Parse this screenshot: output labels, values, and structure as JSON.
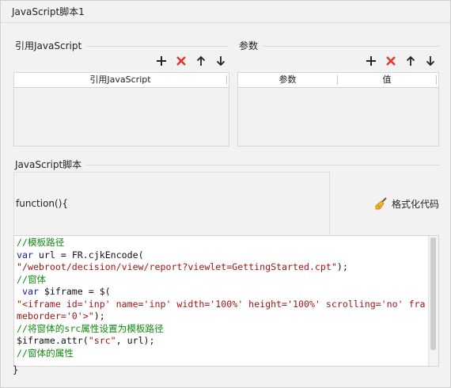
{
  "window": {
    "title": "JavaScript脚本1"
  },
  "ref_section": {
    "label": "引用JavaScript",
    "column_header": "引用JavaScript",
    "rows": []
  },
  "params_section": {
    "label": "参数",
    "columns": [
      "参数",
      "值"
    ],
    "rows": []
  },
  "toolbar": {
    "icons": [
      "plus-icon",
      "delete-icon",
      "arrow-up-icon",
      "arrow-down-icon"
    ],
    "delete_color": "#e8322f"
  },
  "script_section": {
    "label": "JavaScript脚本",
    "function_header": "function(){",
    "format_button": "格式化代码",
    "closing_brace": "}",
    "code_lines": [
      [
        {
          "t": "//模板路径",
          "c": "cmt"
        }
      ],
      [
        {
          "t": "var",
          "c": "kw"
        },
        {
          "t": " url = FR.cjkEncode(",
          "c": "def"
        }
      ],
      [
        {
          "t": "\"/webroot/decision/view/report?viewlet=GettingStarted.cpt\"",
          "c": "str"
        },
        {
          "t": ");",
          "c": "def"
        }
      ],
      [
        {
          "t": "//窗体",
          "c": "cmt"
        }
      ],
      [
        {
          "t": " var",
          "c": "kw"
        },
        {
          "t": " $iframe = $(",
          "c": "def"
        }
      ],
      [
        {
          "t": "\"<iframe id='inp' name='inp' width='100%' height='100%' scrolling='no' fra",
          "c": "str"
        }
      ],
      [
        {
          "t": "meborder='0'>\"",
          "c": "str"
        },
        {
          "t": ");",
          "c": "def"
        }
      ],
      [
        {
          "t": "//将窗体的src属性设置为模板路径",
          "c": "cmt"
        }
      ],
      [
        {
          "t": "$iframe.attr(",
          "c": "def"
        },
        {
          "t": "\"src\"",
          "c": "str"
        },
        {
          "t": ", url);",
          "c": "def"
        }
      ],
      [
        {
          "t": "//窗体的属性",
          "c": "cmt"
        }
      ]
    ]
  }
}
